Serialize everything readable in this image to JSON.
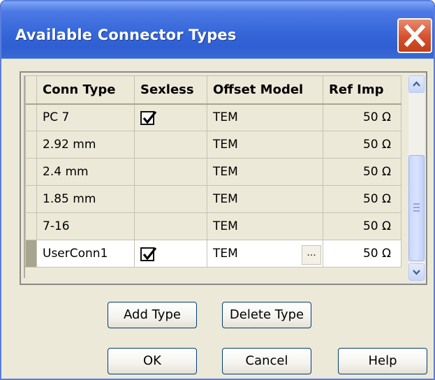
{
  "window": {
    "title": "Available Connector Types"
  },
  "grid": {
    "columns": [
      "Conn Type",
      "Sexless",
      "Offset Model",
      "Ref Imp"
    ],
    "rows": [
      {
        "conn_type": "PC 7",
        "sexless": true,
        "offset_model": "TEM",
        "ref_imp": "50 Ω"
      },
      {
        "conn_type": "2.92 mm",
        "sexless": false,
        "offset_model": "TEM",
        "ref_imp": "50 Ω"
      },
      {
        "conn_type": "2.4 mm",
        "sexless": false,
        "offset_model": "TEM",
        "ref_imp": "50 Ω"
      },
      {
        "conn_type": "1.85 mm",
        "sexless": false,
        "offset_model": "TEM",
        "ref_imp": "50 Ω"
      },
      {
        "conn_type": "7-16",
        "sexless": false,
        "offset_model": "TEM",
        "ref_imp": "50 Ω"
      },
      {
        "conn_type": "UserConn1",
        "sexless": true,
        "offset_model": "TEM",
        "ref_imp": "50 Ω",
        "selected": true
      }
    ],
    "ellipsis_label": "..."
  },
  "buttons": {
    "add_type": "Add Type",
    "delete_type": "Delete Type",
    "ok": "OK",
    "cancel": "Cancel",
    "help": "Help"
  },
  "colors": {
    "title_bar": "#3567d9",
    "close_button": "#d5502c",
    "dialog_background": "#ece9d8"
  },
  "icons": {
    "close": "close-x-icon",
    "check": "checkmark-icon",
    "scroll_up": "chevron-up-icon",
    "scroll_down": "chevron-down-icon"
  }
}
